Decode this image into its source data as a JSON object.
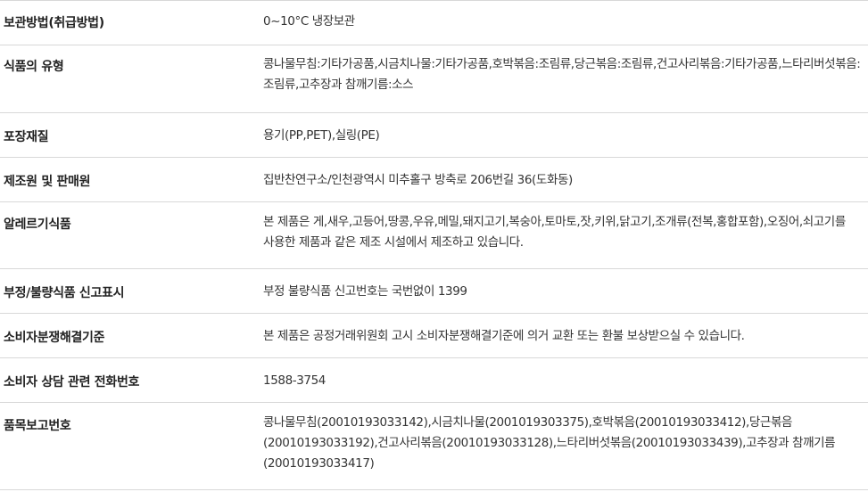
{
  "rows": [
    {
      "label": "보관방법(취급방법)",
      "value": "0~10°C 냉장보관"
    },
    {
      "label": "식품의 유형",
      "value": "콩나물무침:기타가공품,시금치나물:기타가공품,호박볶음:조림류,당근볶음:조림류,건고사리볶음:기타가공품,느타리버섯볶음:조림류,고추장과 참깨기름:소스"
    },
    {
      "label": "포장재질",
      "value": "용기(PP,PET),실링(PE)"
    },
    {
      "label": "제조원 및 판매원",
      "value": "집반찬연구소/인천광역시 미추홀구 방축로 206번길 36(도화동)"
    },
    {
      "label": "알레르기식품",
      "value": "본 제품은 게,새우,고등어,땅콩,우유,메밀,돼지고기,복숭아,토마토,잣,키위,닭고기,조개류(전복,홍합포함),오징어,쇠고기를 사용한 제품과 같은 제조 시설에서 제조하고 있습니다."
    },
    {
      "label": "부정/불량식품 신고표시",
      "value": "부정 불량식품 신고번호는 국번없이 1399"
    },
    {
      "label": "소비자분쟁해결기준",
      "value": "본 제품은 공정거래위원회 고시 소비자분쟁해결기준에 의거 교환 또는 환불 보상받으실 수 있습니다."
    },
    {
      "label": "소비자 상담 관련 전화번호",
      "value": "1588-3754"
    },
    {
      "label": "품목보고번호",
      "value": "콩나물무침(20010193033142),시금치나물(2001019303375),호박볶음(20010193033412),당근볶음(20010193033192),건고사리볶음(20010193033128),느타리버섯볶음(20010193033439),고추장과 참깨기름(20010193033417)"
    }
  ]
}
